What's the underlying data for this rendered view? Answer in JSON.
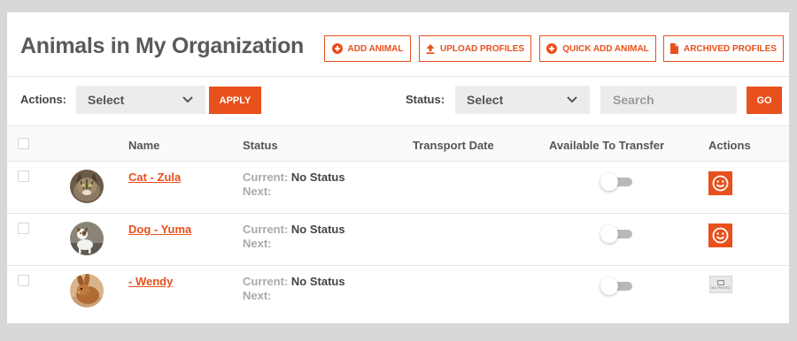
{
  "page": {
    "title": "Animals in My Organization"
  },
  "header_buttons": {
    "add_animal": "ADD ANIMAL",
    "upload_profiles": "UPLOAD PROFILES",
    "quick_add_animal": "QUICK ADD ANIMAL",
    "archived_profiles": "ARCHIVED PROFILES"
  },
  "toolbar": {
    "actions_label": "Actions:",
    "actions_select": "Select",
    "apply_label": "APPLY",
    "status_label": "Status:",
    "status_select": "Select",
    "search_placeholder": "Search",
    "go_label": "GO"
  },
  "table": {
    "columns": [
      "Name",
      "Status",
      "Transport Date",
      "Available To Transfer",
      "Actions"
    ],
    "current_label": "Current:",
    "next_label": "Next:",
    "rows": [
      {
        "name": "Cat - Zula",
        "current": "No Status",
        "next": "",
        "transport_date": "",
        "available": false,
        "avatar": "cat-photo",
        "action": "smiley-icon"
      },
      {
        "name": "Dog - Yuma",
        "current": "No Status",
        "next": "",
        "transport_date": "",
        "available": false,
        "avatar": "dog-photo",
        "action": "smiley-icon"
      },
      {
        "name": "- Wendy",
        "current": "No Status",
        "next": "",
        "transport_date": "",
        "available": false,
        "avatar": "rabbit-photo",
        "action": "no-photo-icon"
      }
    ],
    "no_photo_text": "NO PHOTO"
  },
  "colors": {
    "accent": "#e8501c",
    "title": "#5a5a5a",
    "muted": "#aaaaaa",
    "field_bg": "#ececec"
  }
}
